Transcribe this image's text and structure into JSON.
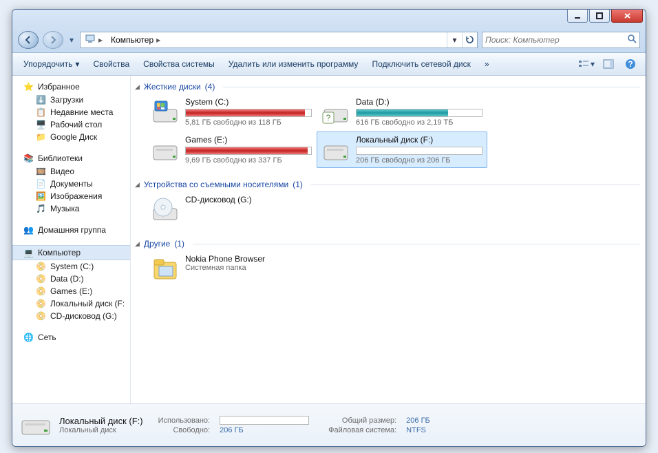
{
  "breadcrumb": {
    "root_icon": "computer-icon",
    "root": "Компьютер"
  },
  "search": {
    "placeholder": "Поиск: Компьютер"
  },
  "toolbar": {
    "organize": "Упорядочить",
    "properties": "Свойства",
    "system_properties": "Свойства системы",
    "uninstall": "Удалить или изменить программу",
    "map_drive": "Подключить сетевой диск"
  },
  "nav": {
    "favorites": {
      "label": "Избранное",
      "items": [
        "Загрузки",
        "Недавние места",
        "Рабочий стол",
        "Google Диск"
      ]
    },
    "libraries": {
      "label": "Библиотеки",
      "items": [
        "Видео",
        "Документы",
        "Изображения",
        "Музыка"
      ]
    },
    "homegroup": {
      "label": "Домашняя группа"
    },
    "computer": {
      "label": "Компьютер",
      "items": [
        "System (C:)",
        "Data (D:)",
        "Games (E:)",
        "Локальный диск (F:",
        "CD-дисковод (G:)"
      ]
    },
    "network": {
      "label": "Сеть"
    }
  },
  "groups": {
    "hdd": {
      "title": "Жесткие диски",
      "count": "(4)",
      "drives": [
        {
          "name": "System (C:)",
          "free": "5,81 ГБ свободно из 118 ГБ",
          "fill": 95,
          "color": "red",
          "icon": "os"
        },
        {
          "name": "Data (D:)",
          "free": "616 ГБ свободно из 2,19 ТБ",
          "fill": 73,
          "color": "teal",
          "icon": "hdd-badge"
        },
        {
          "name": "Games (E:)",
          "free": "9,69 ГБ свободно из 337 ГБ",
          "fill": 97,
          "color": "red",
          "icon": "hdd"
        },
        {
          "name": "Локальный диск (F:)",
          "free": "206 ГБ свободно из 206 ГБ",
          "fill": 0,
          "color": "teal",
          "icon": "hdd",
          "selected": true
        }
      ]
    },
    "removable": {
      "title": "Устройства со съемными носителями",
      "count": "(1)",
      "items": [
        {
          "name": "CD-дисковод (G:)"
        }
      ]
    },
    "other": {
      "title": "Другие",
      "count": "(1)",
      "items": [
        {
          "name": "Nokia Phone Browser",
          "sub": "Системная папка"
        }
      ]
    }
  },
  "details": {
    "title": "Локальный диск (F:)",
    "type": "Локальный диск",
    "used_label": "Использовано:",
    "free_label": "Свободно:",
    "free_value": "206 ГБ",
    "total_label": "Общий размер:",
    "total_value": "206 ГБ",
    "fs_label": "Файловая система:",
    "fs_value": "NTFS"
  }
}
